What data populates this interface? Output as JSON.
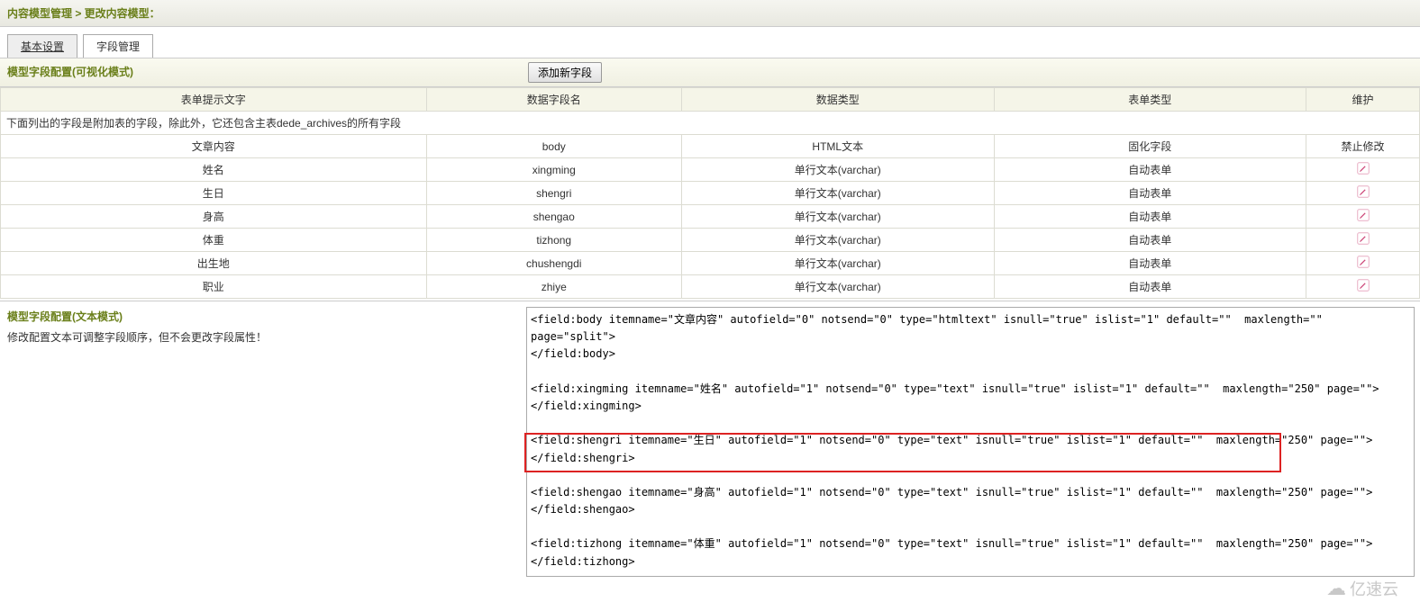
{
  "breadcrumb": "内容模型管理  >  更改内容模型：",
  "tabs": {
    "basic": "基本设置",
    "fields": "字段管理"
  },
  "section_title_visual": "模型字段配置(可视化模式)",
  "add_button": "添加新字段",
  "columns": {
    "prompt": "表单提示文字",
    "fieldname": "数据字段名",
    "datatype": "数据类型",
    "formtype": "表单类型",
    "maint": "维护"
  },
  "note_text": "下面列出的字段是附加表的字段，除此外，它还包含主表dede_archives的所有字段",
  "rows": [
    {
      "prompt": "文章内容",
      "fieldname": "body",
      "datatype": "HTML文本",
      "formtype": "固化字段",
      "maint": "禁止修改",
      "editable": false
    },
    {
      "prompt": "姓名",
      "fieldname": "xingming",
      "datatype": "单行文本(varchar)",
      "formtype": "自动表单",
      "maint": "",
      "editable": true
    },
    {
      "prompt": "生日",
      "fieldname": "shengri",
      "datatype": "单行文本(varchar)",
      "formtype": "自动表单",
      "maint": "",
      "editable": true
    },
    {
      "prompt": "身高",
      "fieldname": "shengao",
      "datatype": "单行文本(varchar)",
      "formtype": "自动表单",
      "maint": "",
      "editable": true
    },
    {
      "prompt": "体重",
      "fieldname": "tizhong",
      "datatype": "单行文本(varchar)",
      "formtype": "自动表单",
      "maint": "",
      "editable": true
    },
    {
      "prompt": "出生地",
      "fieldname": "chushengdi",
      "datatype": "单行文本(varchar)",
      "formtype": "自动表单",
      "maint": "",
      "editable": true
    },
    {
      "prompt": "职业",
      "fieldname": "zhiye",
      "datatype": "单行文本(varchar)",
      "formtype": "自动表单",
      "maint": "",
      "editable": true
    }
  ],
  "text_section_title": "模型字段配置(文本模式)",
  "text_section_note": "修改配置文本可调整字段顺序，但不会更改字段属性！",
  "textarea_content": "<field:body itemname=\"文章内容\" autofield=\"0\" notsend=\"0\" type=\"htmltext\" isnull=\"true\" islist=\"1\" default=\"\"  maxlength=\"\" page=\"split\">\n</field:body>\n\n<field:xingming itemname=\"姓名\" autofield=\"1\" notsend=\"0\" type=\"text\" isnull=\"true\" islist=\"1\" default=\"\"  maxlength=\"250\" page=\"\">\n</field:xingming>\n\n<field:shengri itemname=\"生日\" autofield=\"1\" notsend=\"0\" type=\"text\" isnull=\"true\" islist=\"1\" default=\"\"  maxlength=\"250\" page=\"\">\n</field:shengri>\n\n<field:shengao itemname=\"身高\" autofield=\"1\" notsend=\"0\" type=\"text\" isnull=\"true\" islist=\"1\" default=\"\"  maxlength=\"250\" page=\"\">\n</field:shengao>\n\n<field:tizhong itemname=\"体重\" autofield=\"1\" notsend=\"0\" type=\"text\" isnull=\"true\" islist=\"1\" default=\"\"  maxlength=\"250\" page=\"\">\n</field:tizhong>\n\n<field:chushengdi itemname=\"出生地\" autofield=\"1\" notsend=\"0\" type=\"text\" isnull=\"true\" islist=\"1\" default=\"\"  maxlength=\"250\" page=\"\">\n</field:chushengdi>\n\n<field:zhiye itemname=\"职业\" autofield=\"1\" notsend=\"0\" type=\"text\" isnull=\"true\" islist=\"1\" default=\"\"  maxl",
  "watermark": "亿速云"
}
